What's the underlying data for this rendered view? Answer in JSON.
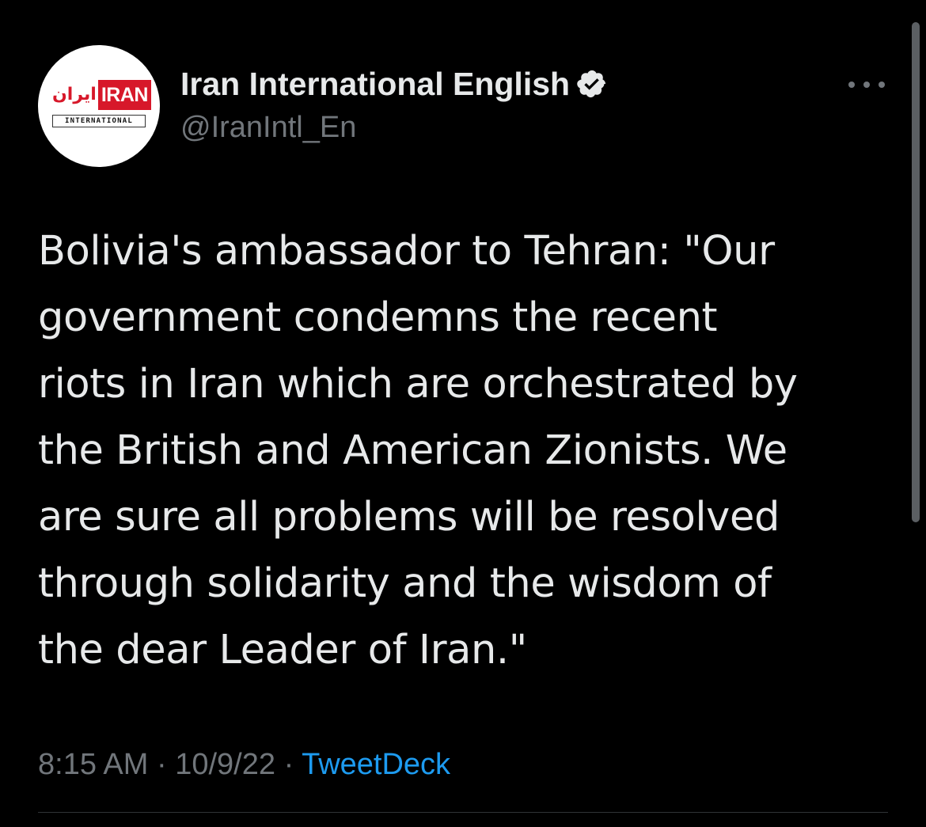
{
  "author": {
    "display_name": "Iran International English",
    "handle": "@IranIntl_En",
    "verified": true,
    "avatar": {
      "logo_fa": "ایران",
      "logo_en": "IRAN",
      "logo_sub": "INTERNATIONAL"
    }
  },
  "tweet": {
    "text": "Bolivia's ambassador to Tehran: \"Our\ngovernment condemns the recent\nriots in Iran which are orchestrated by\nthe British and American Zionists. We\nare sure all problems will be resolved\nthrough solidarity and the wisdom of\nthe dear Leader of Iran.\"",
    "time": "8:15 AM",
    "separator": "·",
    "date": "10/9/22",
    "source": "TweetDeck"
  },
  "icons": {
    "more": "more-horizontal-icon",
    "verified": "verified-badge-icon"
  },
  "colors": {
    "background": "#000000",
    "text": "#e7e9ea",
    "muted": "#71767b",
    "link": "#1d9bf0",
    "brand_red": "#d7182a"
  }
}
